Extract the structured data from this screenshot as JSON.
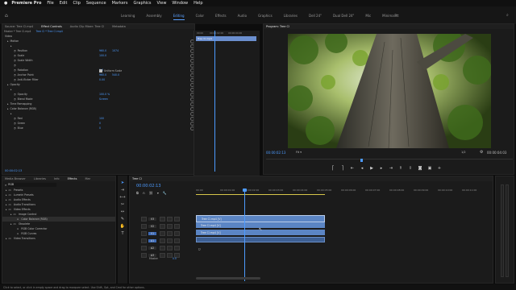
{
  "menubar": {
    "apple": "",
    "app_name": "Premiere Pro",
    "items": [
      "File",
      "Edit",
      "Clip",
      "Sequence",
      "Markers",
      "Graphics",
      "View",
      "Window",
      "Help"
    ]
  },
  "workspaces": [
    "Learning",
    "Assembly",
    "Editing",
    "Color",
    "Effects",
    "Audio",
    "Graphics",
    "Libraries",
    "Dell 24\"",
    "Dual Dell 24\"",
    "Mic",
    "Minimalist"
  ],
  "active_workspace": "Editing",
  "source_panel": {
    "tabs": [
      "Source: Tree Cl.mp4",
      "Effect Controls",
      "Audio Clip Mixer: Tree Cl",
      "Metadata"
    ],
    "master_label": "Master * Tree Cl.mp4",
    "clip_label": "Tree Cl * Tree Cl.mp4",
    "video_label": "Video",
    "mini_ruler": [
      "00:00",
      "00:00:02:00",
      "00:00:04:00"
    ],
    "clip_bar": "Tree Cl.mp4",
    "rows": [
      {
        "label": "Motion",
        "indent": 1,
        "v1": "",
        "v2": ""
      },
      {
        "label": "",
        "indent": 2,
        "v1": "",
        "v2": ""
      },
      {
        "label": "Position",
        "indent": 3,
        "v1": "960.0",
        "v2": "1074"
      },
      {
        "label": "Scale",
        "indent": 3,
        "v1": "100.0",
        "v2": ""
      },
      {
        "label": "Scale Width",
        "indent": 3,
        "v1": "",
        "v2": ""
      },
      {
        "label": "",
        "indent": 3,
        "v1": "",
        "v2": ""
      },
      {
        "label": "Rotation",
        "indent": 3,
        "v1": "0.0",
        "v2": ""
      },
      {
        "label": "Anchor Point",
        "indent": 3,
        "v1": "960.0",
        "v2": "540.0"
      },
      {
        "label": "Anti-flicker Filter",
        "indent": 3,
        "v1": "0.00",
        "v2": ""
      },
      {
        "label": "Opacity",
        "indent": 1,
        "v1": "",
        "v2": ""
      },
      {
        "label": "",
        "indent": 2,
        "v1": "",
        "v2": ""
      },
      {
        "label": "Opacity",
        "indent": 3,
        "v1": "100.0 %",
        "v2": ""
      },
      {
        "label": "Blend Mode",
        "indent": 3,
        "v1": "Screen",
        "v2": ""
      },
      {
        "label": "Time Remapping",
        "indent": 1,
        "v1": "",
        "v2": ""
      },
      {
        "label": "Color Balance (RGB)",
        "indent": 1,
        "v1": "",
        "v2": ""
      },
      {
        "label": "",
        "indent": 2,
        "v1": "",
        "v2": ""
      },
      {
        "label": "Red",
        "indent": 3,
        "v1": "100",
        "v2": ""
      },
      {
        "label": "Green",
        "indent": 3,
        "v1": "0",
        "v2": ""
      },
      {
        "label": "Blue",
        "indent": 3,
        "v1": "0",
        "v2": ""
      }
    ],
    "uniform_scale": "Uniform Scale",
    "bottom_tc": "00:00:02:13"
  },
  "program": {
    "title": "Program: Tree Cl",
    "timecode": "00:00:02:13",
    "fit": "Fit",
    "fraction": "1/2",
    "duration": "00:00:04:03"
  },
  "project_panel": {
    "tabs": [
      "Media Browser",
      "Libraries",
      "Info",
      "Effects",
      "Mar"
    ],
    "search_value": "RGB",
    "items": [
      {
        "label": "Presets",
        "depth": 0
      },
      {
        "label": "Lumetri Presets",
        "depth": 0
      },
      {
        "label": "Audio Effects",
        "depth": 0
      },
      {
        "label": "Audio Transitions",
        "depth": 0
      },
      {
        "label": "Video Effects",
        "depth": 0
      },
      {
        "label": "Image Control",
        "depth": 1
      },
      {
        "label": "Color Balance (RGB)",
        "depth": 2,
        "selected": true
      },
      {
        "label": "Obsolete",
        "depth": 1
      },
      {
        "label": "RGB Color Corrector",
        "depth": 2
      },
      {
        "label": "RGB Curves",
        "depth": 2
      },
      {
        "label": "Video Transitions",
        "depth": 0
      }
    ]
  },
  "timeline": {
    "tab": "Tree Cl",
    "timecode": "00:00:02:13",
    "ruler": [
      "00:00",
      "00:00:01:00",
      "00:00:02:00",
      "00:00:03:00",
      "00:00:04:00",
      "00:00:05:00",
      "00:00:06:00",
      "00:00:07:00",
      "00:00:08:00",
      "00:00:09:00",
      "00:00:10:00",
      "00:00:11:00"
    ],
    "video_tracks": [
      "V3",
      "V2",
      "V1"
    ],
    "audio_tracks": [
      "A1",
      "A2",
      "A3"
    ],
    "master_label": "Master",
    "master_value": "0.0",
    "clips": [
      {
        "label": "Tree Cl.mp4 [V]",
        "track": "V3"
      },
      {
        "label": "Tree Cl.mp4 [V]",
        "track": "V2"
      },
      {
        "label": "Tree Cl.mp4 [V]",
        "track": "V1"
      },
      {
        "label": "",
        "track": "A1"
      }
    ]
  },
  "status_bar": "Click to select, or click in empty space and drag to marquee select. Use Shift, Opt, and Cmd for other options.",
  "colors": {
    "accent": "#4d9bff",
    "clip_blue": "#5b85c4",
    "clip_blue_dark": "#3d5f93"
  }
}
